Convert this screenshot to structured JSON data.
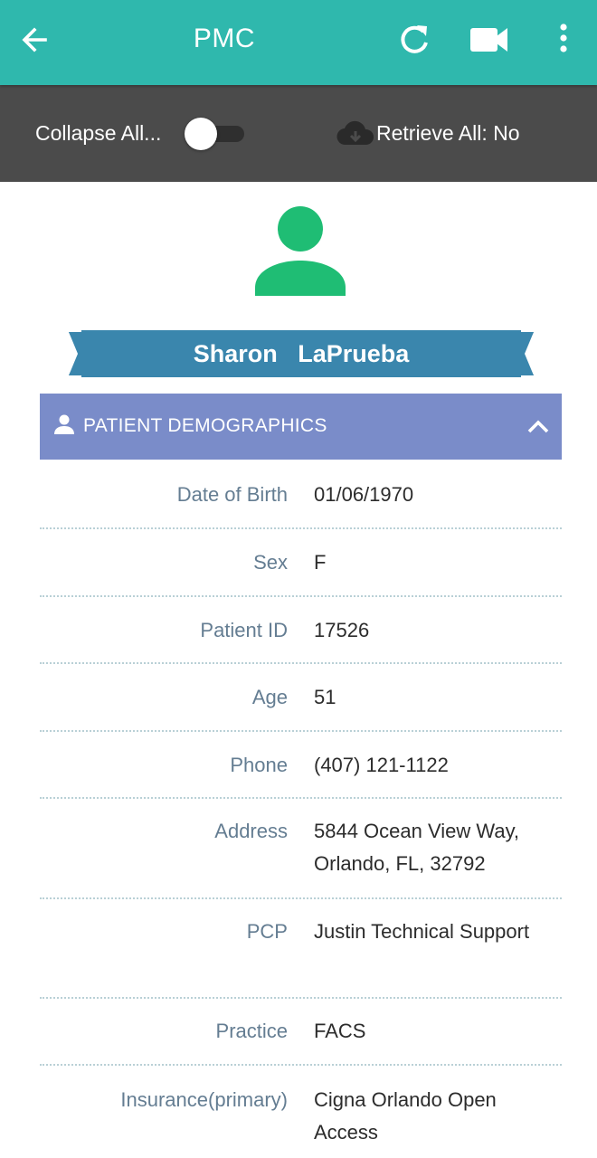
{
  "appbar": {
    "title": "PMC",
    "icons": [
      "arrow-back-icon",
      "refresh-icon",
      "video-camera-icon",
      "more-vert-icon"
    ],
    "color": "#2fb8ad"
  },
  "toolbar": {
    "collapse_label": "Collapse All...",
    "collapse_on": false,
    "retrieve_label": "Retrieve All: No",
    "color": "#4b4b4b"
  },
  "patient": {
    "first_name": "Sharon",
    "last_name": "LaPrueba",
    "full_name_display": "Sharon   LaPrueba"
  },
  "section": {
    "title": "PATIENT DEMOGRAPHICS",
    "color": "#7a8cc9"
  },
  "demographics": [
    {
      "label": "Date of Birth",
      "value": "01/06/1970"
    },
    {
      "label": "Sex",
      "value": "F"
    },
    {
      "label": "Patient ID",
      "value": "17526"
    },
    {
      "label": "Age",
      "value": "51"
    },
    {
      "label": "Phone",
      "value": "(407) 121-1122"
    },
    {
      "label": "Address",
      "value": "5844 Ocean View Way, Orlando, FL, 32792"
    },
    {
      "label": "PCP",
      "value": "Justin Technical Support"
    },
    {
      "label": "Practice",
      "value": "FACS"
    },
    {
      "label": "Insurance(primary)",
      "value": "Cigna Orlando Open Access"
    }
  ],
  "colors": {
    "avatar": "#1fbd74",
    "ribbon": "#3a86ad",
    "ribbon_tail": "#2b6f92",
    "label_text": "#647d92"
  }
}
